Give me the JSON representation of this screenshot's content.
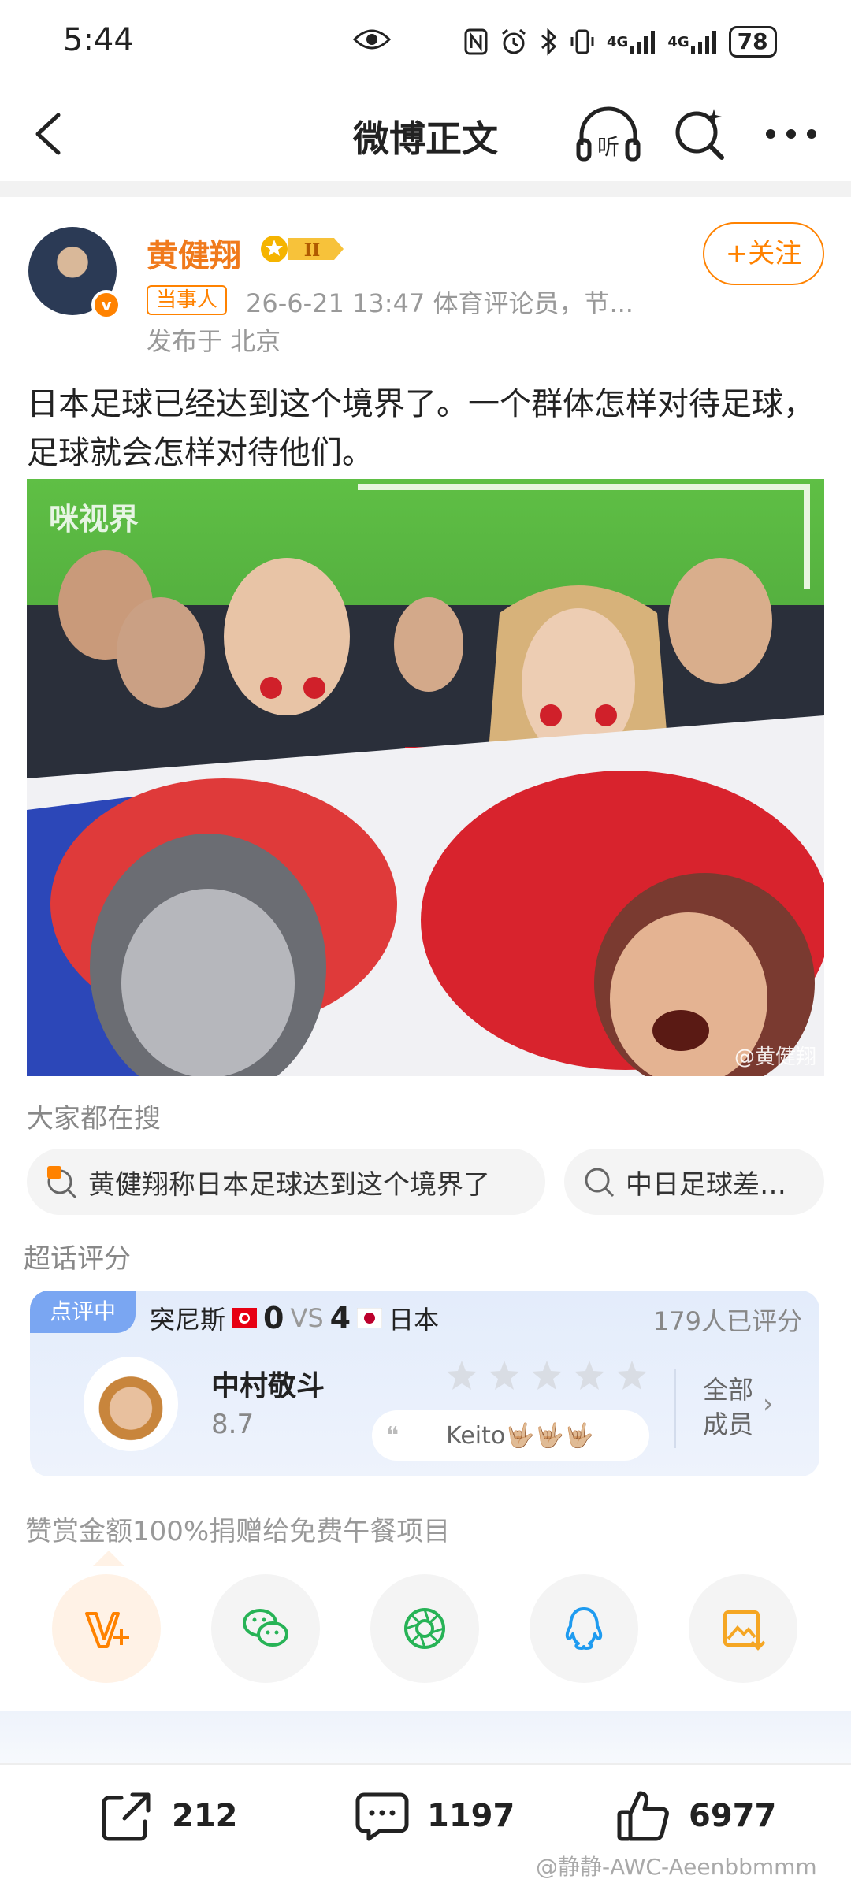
{
  "status": {
    "time": "5:44",
    "network_1": "4G",
    "network_2": "4G",
    "battery": "78"
  },
  "nav": {
    "title": "微博正文",
    "listen_label": "听"
  },
  "author": {
    "name": "黄健翔",
    "vip_level": "II",
    "follow_label": "+关注",
    "tag": "当事人",
    "meta": "26-6-21 13:47  体育评论员，节...",
    "location": "发布于 北京",
    "verified_mark": "v"
  },
  "post": {
    "text": "日本足球已经达到这个境界了。一个群体怎样对待足球，足球就会怎样对待他们。",
    "image_logo": "咪视界",
    "image_watermark": "@黄健翔"
  },
  "search": {
    "label": "大家都在搜",
    "chips": [
      {
        "text": "黄健翔称日本足球达到这个境界了",
        "icon": "hot-search-icon"
      },
      {
        "text": "中日足球差…",
        "icon": "search-icon"
      }
    ]
  },
  "rating": {
    "section_label": "超话评分",
    "tag": "点评中",
    "team_home": "突尼斯",
    "score_home": "0",
    "vs": "VS",
    "score_away": "4",
    "team_away": "日本",
    "rated_count": "179人已评分",
    "player_name": "中村敬斗",
    "player_score": "8.7",
    "stars_filled": 0,
    "stars_total": 5,
    "comment": "Keito🤟🏼🤟🏼🤟🏼",
    "all_members_line1": "全部",
    "all_members_line2": "成员",
    "chevron": "›",
    "colors": {
      "tag": "#7aa6f2",
      "card": "#e3ecfb"
    }
  },
  "donate": {
    "text": "赞赏金额100%捐赠给免费午餐项目",
    "share_icons": [
      "v-plus-icon",
      "wechat-icon",
      "moments-icon",
      "qq-icon",
      "save-image-icon"
    ]
  },
  "actions": {
    "repost_count": "212",
    "comment_count": "1197",
    "like_count": "6977"
  },
  "watermark": "@静静-AWC-Aeenbbmmm",
  "colors": {
    "brand_orange": "#ff8200",
    "name_orange": "#f07a1c"
  }
}
